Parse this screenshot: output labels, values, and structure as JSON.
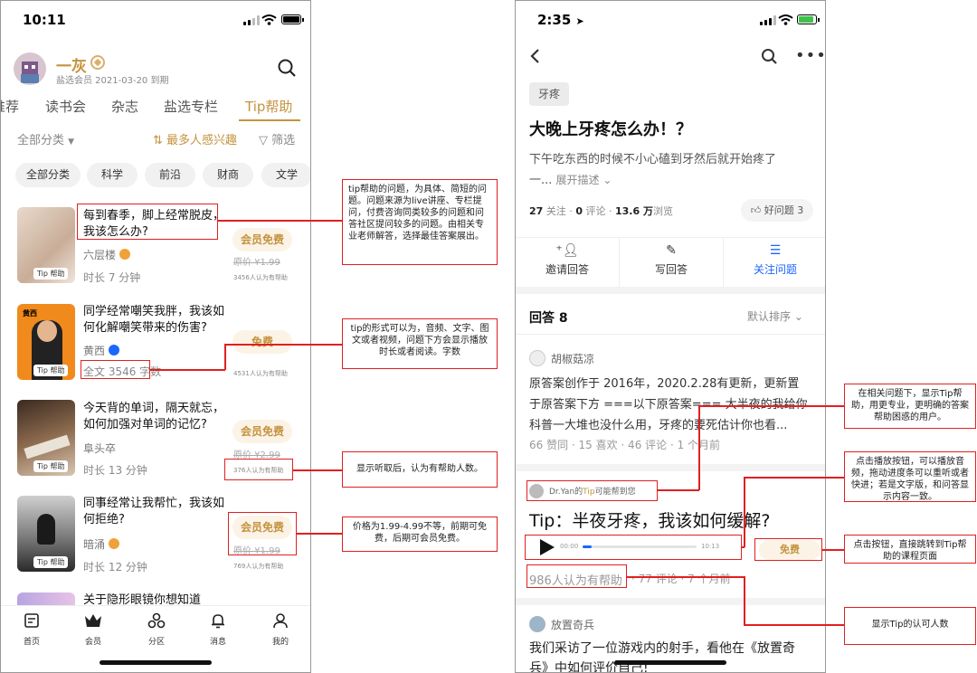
{
  "left": {
    "status_time": "10:11",
    "user": {
      "name": "一灰",
      "member": "盐选会员 2021-03-20 到期"
    },
    "tabs": [
      "推荐",
      "读书会",
      "杂志",
      "盐选专栏",
      "Tip帮助"
    ],
    "filter": {
      "category": "全部分类",
      "sort": "最多人感兴趣",
      "filter": "筛选"
    },
    "chips": [
      "全部分类",
      "科学",
      "前沿",
      "财商",
      "文学"
    ],
    "items": [
      {
        "title": "每到春季，脚上经常脱皮，我该怎么办?",
        "author": "六层楼",
        "meta": "时长  7  分钟",
        "button": "会员免费",
        "orig": "原价 ¥1.99",
        "helped": "3456人认为有帮助",
        "tag": "Tip 帮助"
      },
      {
        "title": "同学经常嘲笑我胖，我该如何化解嘲笑带来的伤害?",
        "author": "黄西",
        "meta": "全文 3546 字数",
        "button": "免费",
        "orig": "",
        "helped": "4531人认为有帮助",
        "tag": "Tip 帮助",
        "thumb_text": "黄西"
      },
      {
        "title": "今天背的单词，隔天就忘，如何加强对单词的记忆?",
        "author": "阜头卒",
        "meta": "时长  13  分钟",
        "button": "会员免费",
        "orig": "原价 ¥2.99",
        "helped": "376人认为有帮助",
        "tag": "Tip 帮助"
      },
      {
        "title": "同事经常让我帮忙，我该如何拒绝?",
        "author": "暗涌",
        "meta": "时长  12  分钟",
        "button": "会员免费",
        "orig": "原价 ¥1.99",
        "helped": "769人认为有帮助",
        "tag": "Tip 帮助"
      },
      {
        "title": "关于隐形眼镜你想知道"
      }
    ],
    "nav": [
      "首页",
      "会员",
      "分区",
      "消息",
      "我的"
    ]
  },
  "notes_left": [
    "tip帮助的问题，为具体、简短的问题。问题来源为live讲座、专栏提问，付费咨询同类较多的问题和问答社区提问较多的问题。由相关专业老师解答，选择最佳答案展出。",
    "tip的形式可以为，音频、文字、图文或者视频，问题下方会显示播放时长或者阅读。字数",
    "显示听取后，认为有帮助人数。",
    "价格为1.99-4.99不等，前期可免费，后期可会员免费。"
  ],
  "right": {
    "status_time": "2:35",
    "topic_tag": "牙疼",
    "question_title": "大晚上牙疼怎么办！？",
    "desc_line1": "下午吃东西的时候不小心磕到牙然后就开始疼了",
    "desc_line2": "一...",
    "expand": "展开描述",
    "stats": {
      "follow_n": "27",
      "follow_l": "关注",
      "comment_n": "0",
      "comment_l": "评论",
      "view_n": "13.6 万",
      "view_l": "浏览",
      "good_q": "好问题 3"
    },
    "actions": [
      "邀请回答",
      "写回答",
      "关注问题"
    ],
    "answers_label": "回答 8",
    "sort": "默认排序",
    "answer1": {
      "author": "胡椒菇凉",
      "lines": [
        "原答案创作于 2016年，2020.2.28有更新，更新置",
        "于原答案下方 ===以下原答案=== 大半夜的我给你",
        "科普一大堆也没什么用，牙疼的要死估计你也看..."
      ],
      "meta": "66 赞同  ·  15 喜欢  ·  46 评论  ·  1 个月前"
    },
    "tip": {
      "helper_prefix": "Dr.Yan的",
      "helper_tip": "Tip",
      "helper_suffix": "可能帮到您",
      "title": "Tip：半夜牙疼，我该如何缓解?",
      "time_start": "00:00",
      "time_end": "10:13",
      "progress": 0.08,
      "button": "免费",
      "helped": "986人认为有帮助",
      "meta": "·  77 评论  ·  7 个月前"
    },
    "answer2": {
      "author": "放置奇兵",
      "lines": [
        "我们采访了一位游戏内的射手，看他在《放置奇",
        "兵》中如何评价自己!"
      ]
    }
  },
  "notes_right": [
    "在相关问题下，显示Tip帮助，用更专业，更明确的答案帮助困惑的用户。",
    "点击播放按钮，可以播放音频，拖动进度条可以重听或者快进；若是文字版，和问答显示内容一致。",
    "点击按钮，直接跳转到Tip帮助的课程页面",
    "显示Tip的认可人数"
  ],
  "colors": {
    "accent": "#c4933f",
    "blue": "#1a66ff",
    "annotation": "#e02020"
  }
}
